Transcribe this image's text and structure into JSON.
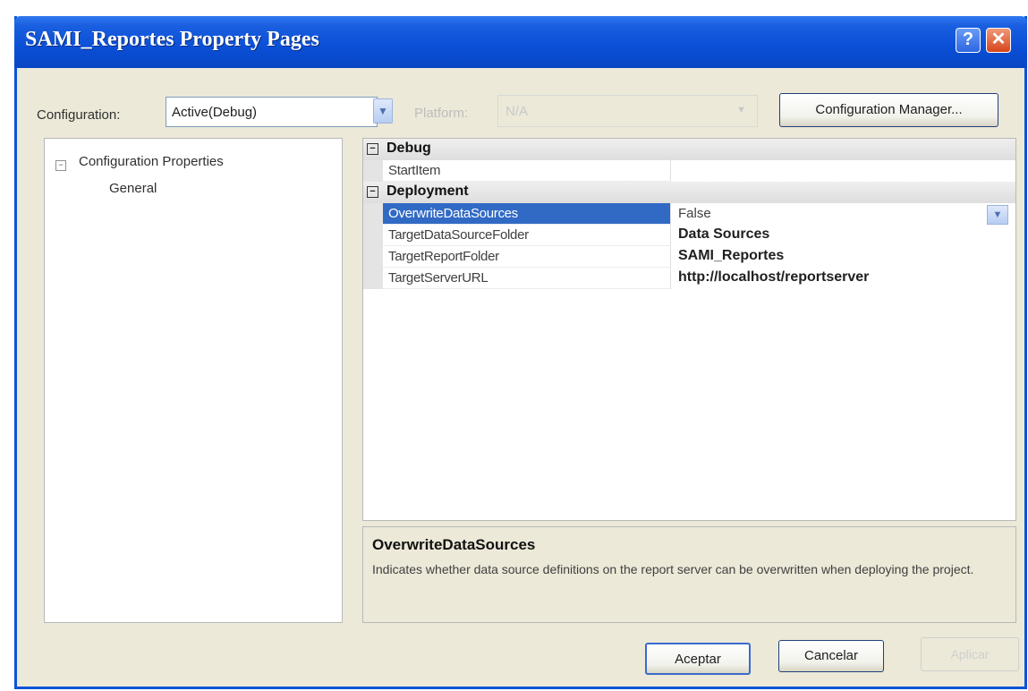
{
  "window": {
    "title": "SAMI_Reportes Property Pages",
    "help_glyph": "?",
    "close_glyph": "✕"
  },
  "toolbar": {
    "configuration_label": "Configuration:",
    "configuration_value": "Active(Debug)",
    "platform_label": "Platform:",
    "platform_value": "N/A",
    "configuration_manager_label": "Configuration Manager..."
  },
  "tree": {
    "root_label": "Configuration Properties",
    "children": [
      "General"
    ]
  },
  "grid": {
    "categories": [
      {
        "name": "Debug",
        "properties": [
          {
            "name": "StartItem",
            "value": ""
          }
        ]
      },
      {
        "name": "Deployment",
        "properties": [
          {
            "name": "OverwriteDataSources",
            "value": "False"
          },
          {
            "name": "TargetDataSourceFolder",
            "value": "Data Sources"
          },
          {
            "name": "TargetReportFolder",
            "value": "SAMI_Reportes"
          },
          {
            "name": "TargetServerURL",
            "value": "http://localhost/reportserver"
          }
        ]
      }
    ],
    "selected_property": "OverwriteDataSources"
  },
  "description": {
    "title": "OverwriteDataSources",
    "text": "Indicates whether data source definitions on the report server can be overwritten when deploying the project."
  },
  "buttons": {
    "ok_label": "Aceptar",
    "cancel_label": "Cancelar",
    "apply_label": "Aplicar"
  },
  "colors": {
    "titlebar": "#0a4fd6",
    "selection": "#316ac5",
    "dialog_background": "#ece9d8"
  }
}
